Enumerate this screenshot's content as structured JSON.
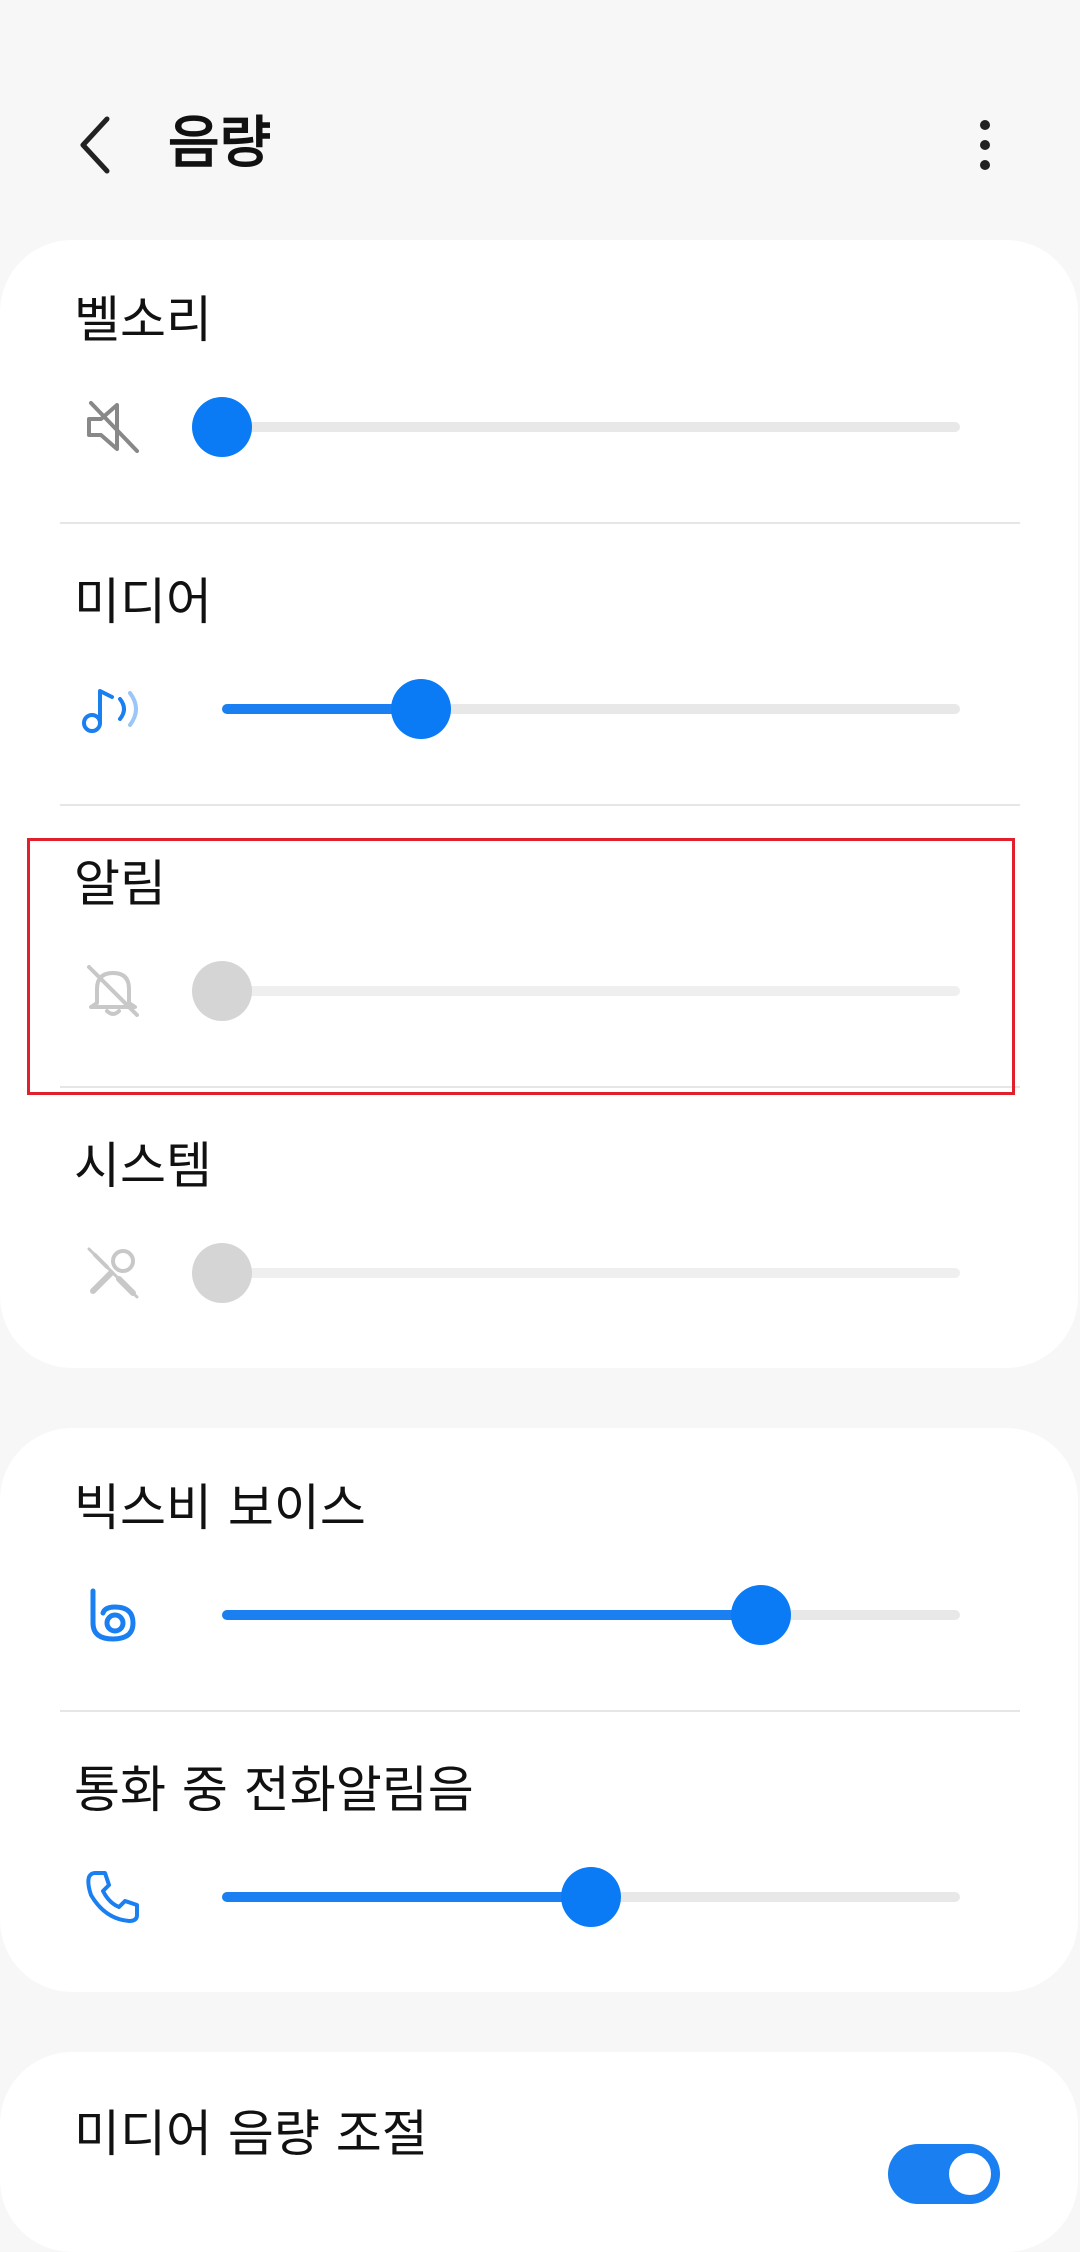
{
  "header": {
    "title": "음량",
    "back_icon": "chevron-left-icon",
    "more_icon": "more-vertical-icon"
  },
  "volumes": [
    {
      "label": "벨소리",
      "icon": "mute-speaker-icon",
      "level": 0.0,
      "enabled": true
    },
    {
      "label": "미디어",
      "icon": "music-note-wave-icon",
      "level": 0.27,
      "enabled": true
    },
    {
      "label": "알림",
      "icon": "bell-off-icon",
      "level": 0.0,
      "enabled": false
    },
    {
      "label": "시스템",
      "icon": "tools-off-icon",
      "level": 0.0,
      "enabled": false
    }
  ],
  "assistant_volumes": [
    {
      "label": "빅스비 보이스",
      "icon": "bixby-icon",
      "level": 0.73,
      "enabled": true
    },
    {
      "label": "통화 중 전화알림음",
      "icon": "phone-icon",
      "level": 0.5,
      "enabled": true
    }
  ],
  "media_control": {
    "label": "미디어 음량 조절",
    "toggle_on": true
  },
  "colors": {
    "accent": "#1a7ff0",
    "disabled": "#d5d5d5",
    "highlight": "#e0202c"
  }
}
